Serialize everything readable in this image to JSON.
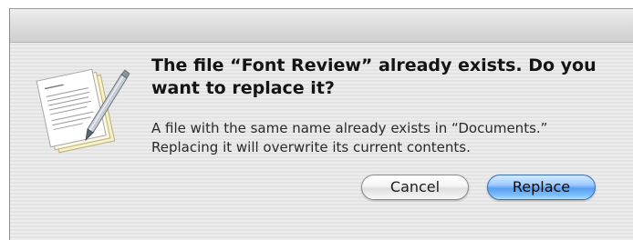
{
  "dialog": {
    "headline": "The file “Font Review” already exists. Do you want to replace it?",
    "message": "A file with the same name already exists in “Documents.” Replacing it will overwrite its current contents.",
    "buttons": {
      "cancel_label": "Cancel",
      "replace_label": "Replace"
    },
    "icon": "textedit-document-pen-icon"
  },
  "colors": {
    "default_button": "#5a9ef0",
    "dialog_background": "#ececec"
  }
}
